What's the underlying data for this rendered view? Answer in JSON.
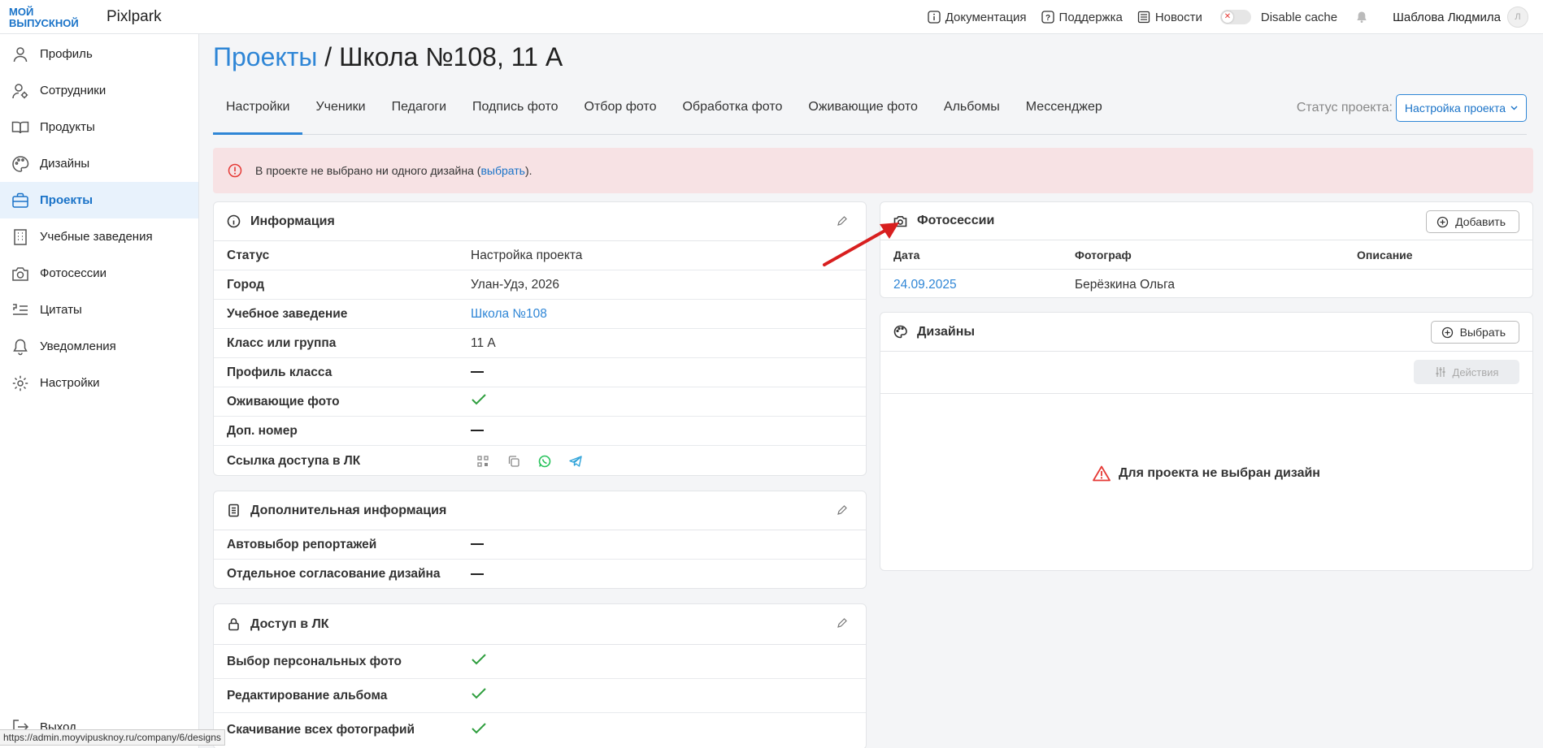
{
  "header": {
    "logo_text": [
      "МОЙ",
      "ВЫПУСКНОЙ"
    ],
    "brand": "Pixlpark",
    "links": [
      "Документация",
      "Поддержка",
      "Новости"
    ],
    "cache_label": "Disable cache",
    "user_name": "Шаблова Людмила",
    "avatar_initial": "Л"
  },
  "sidebar": {
    "items": [
      {
        "label": "Профиль",
        "icon": "user-icon"
      },
      {
        "label": "Сотрудники",
        "icon": "user-gear-icon"
      },
      {
        "label": "Продукты",
        "icon": "book-icon"
      },
      {
        "label": "Дизайны",
        "icon": "palette-icon"
      },
      {
        "label": "Проекты",
        "icon": "briefcase-icon",
        "active": true
      },
      {
        "label": "Учебные заведения",
        "icon": "building-icon"
      },
      {
        "label": "Фотосессии",
        "icon": "camera-icon"
      },
      {
        "label": "Цитаты",
        "icon": "quote-icon"
      },
      {
        "label": "Уведомления",
        "icon": "bell-icon"
      },
      {
        "label": "Настройки",
        "icon": "gear-icon"
      }
    ],
    "exit_label": "Выход"
  },
  "page": {
    "crumb_link": "Проекты",
    "crumb_sep": " / ",
    "crumb_title": "Школа №108, 11 А"
  },
  "tabs": [
    "Настройки",
    "Ученики",
    "Педагоги",
    "Подпись фото",
    "Отбор фото",
    "Обработка фото",
    "Оживающие фото",
    "Альбомы",
    "Мессенджер"
  ],
  "status": {
    "label": "Статус проекта:",
    "value": "Настройка проекта"
  },
  "alert": {
    "text_before": "В проекте не выбрано ни одного дизайна (",
    "link": "выбрать",
    "text_after": ")."
  },
  "info_card": {
    "title": "Информация",
    "rows": [
      {
        "key": "Статус",
        "value": "Настройка проекта"
      },
      {
        "key": "Город",
        "value": "Улан-Удэ, 2026"
      },
      {
        "key": "Учебное заведение",
        "value": "Школа №108"
      },
      {
        "key": "Класс или группа",
        "value": "11 А"
      },
      {
        "key": "Профиль класса",
        "value": "—"
      },
      {
        "key": "Оживающие фото",
        "value": "check"
      },
      {
        "key": "Доп. номер",
        "value": "—"
      },
      {
        "key": "Ссылка доступа в ЛК",
        "value": "icons"
      }
    ]
  },
  "extra_card": {
    "title": "Дополнительная информация",
    "rows": [
      {
        "key": "Автовыбор репортажей",
        "value": "—"
      },
      {
        "key": "Отдельное согласование дизайна",
        "value": "—"
      }
    ]
  },
  "access_card": {
    "title": "Доступ в ЛК",
    "rows": [
      {
        "key": "Выбор персональных фото",
        "value": "check"
      },
      {
        "key": "Редактирование альбома",
        "value": "check"
      },
      {
        "key": "Скачивание всех фотографий",
        "value": "check"
      }
    ]
  },
  "photo_card": {
    "title": "Фотосессии",
    "add_label": "Добавить",
    "columns": [
      "Дата",
      "Фотограф",
      "Описание"
    ],
    "rows": [
      {
        "date": "24.09.2025",
        "photographer": "Берёзкина Ольга",
        "description": ""
      }
    ]
  },
  "design_card": {
    "title": "Дизайны",
    "choose_label": "Выбрать",
    "actions_label": "Действия",
    "empty_text": "Для проекта не выбран дизайн"
  },
  "status_bar_url": "https://admin.moyvipusknoy.ru/company/6/designs",
  "colors": {
    "accent": "#2f86d6",
    "alert_bg": "#f7e2e4",
    "check": "#2e9e3e",
    "error": "#e53935"
  }
}
